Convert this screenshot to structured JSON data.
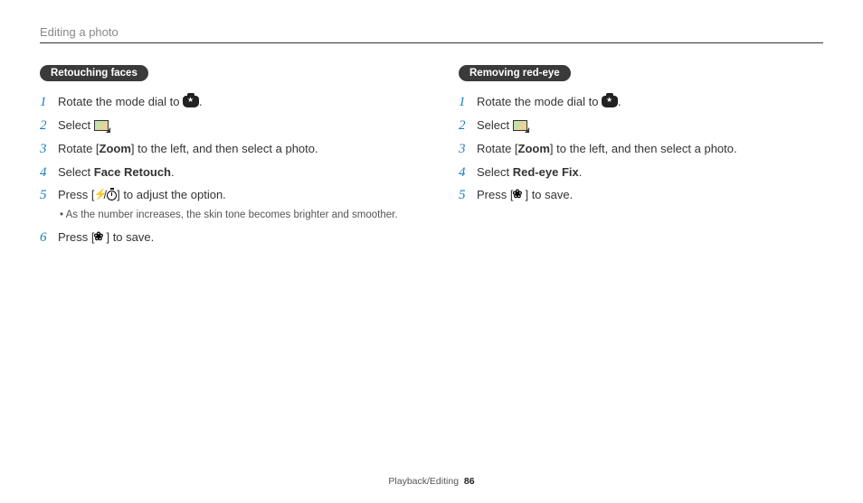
{
  "title": "Editing a photo",
  "left": {
    "heading": "Retouching faces",
    "s1a": "Rotate the mode dial to ",
    "s1b": ".",
    "s2a": "Select ",
    "s2b": ".",
    "s3a": "Rotate [",
    "s3b": "Zoom",
    "s3c": "] to the left, and then select a photo.",
    "s4a": "Select ",
    "s4b": "Face Retouch",
    "s4c": ".",
    "s5a": "Press [",
    "s5b": "/",
    "s5c": "] to adjust the option.",
    "s5note": "As the number increases, the skin tone becomes brighter and smoother.",
    "s6a": "Press [",
    "s6b": "] to save."
  },
  "right": {
    "heading": "Removing red-eye",
    "s1a": "Rotate the mode dial to ",
    "s1b": ".",
    "s2a": "Select ",
    "s2b": ".",
    "s3a": "Rotate [",
    "s3b": "Zoom",
    "s3c": "] to the left, and then select a photo.",
    "s4a": "Select ",
    "s4b": "Red-eye Fix",
    "s4c": ".",
    "s5a": "Press [",
    "s5b": "] to save."
  },
  "footer_section": "Playback/Editing",
  "footer_page": "86"
}
